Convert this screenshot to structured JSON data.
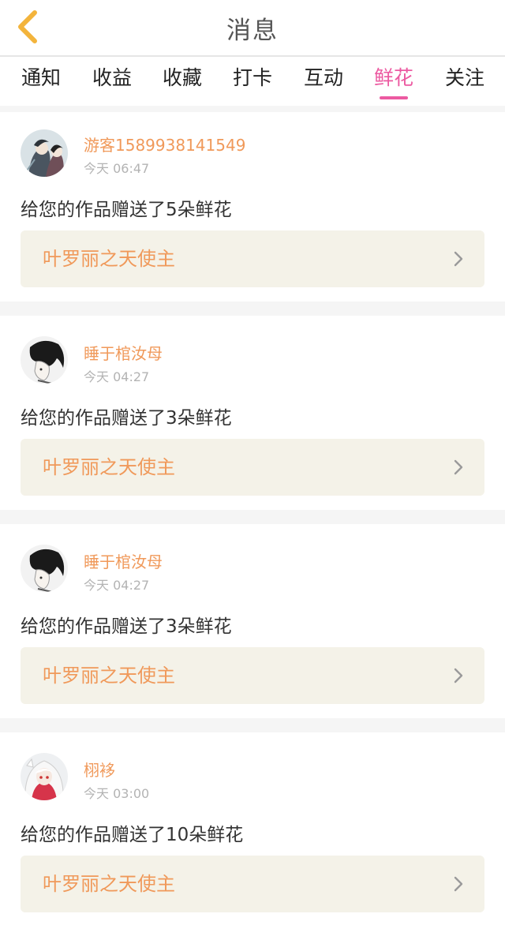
{
  "header": {
    "title": "消息",
    "back_icon": "chevron-left-icon",
    "back_color": "#f3b43c"
  },
  "tabs": [
    {
      "label": "通知",
      "active": false
    },
    {
      "label": "收益",
      "active": false
    },
    {
      "label": "收藏",
      "active": false
    },
    {
      "label": "打卡",
      "active": false
    },
    {
      "label": "互动",
      "active": false
    },
    {
      "label": "鲜花",
      "active": true
    },
    {
      "label": "关注",
      "active": false
    }
  ],
  "colors": {
    "accent_pink": "#ec5aa1",
    "username_orange": "#f0995a",
    "work_bg": "#f4f2e8"
  },
  "messages": [
    {
      "username": "游客1589938141549",
      "time": "今天 06:47",
      "text": "给您的作品赠送了5朵鲜花",
      "work": "叶罗丽之天使主",
      "avatar": "anime-couple-avatar"
    },
    {
      "username": "睡于棺汝母",
      "time": "今天 04:27",
      "text": "给您的作品赠送了3朵鲜花",
      "work": "叶罗丽之天使主",
      "avatar": "sketch-boy-avatar"
    },
    {
      "username": "睡于棺汝母",
      "time": "今天 04:27",
      "text": "给您的作品赠送了3朵鲜花",
      "work": "叶罗丽之天使主",
      "avatar": "sketch-boy-avatar"
    },
    {
      "username": "栩袳",
      "time": "今天 03:00",
      "text": "给您的作品赠送了10朵鲜花",
      "work": "叶罗丽之天使主",
      "avatar": "white-hair-girl-avatar"
    }
  ]
}
